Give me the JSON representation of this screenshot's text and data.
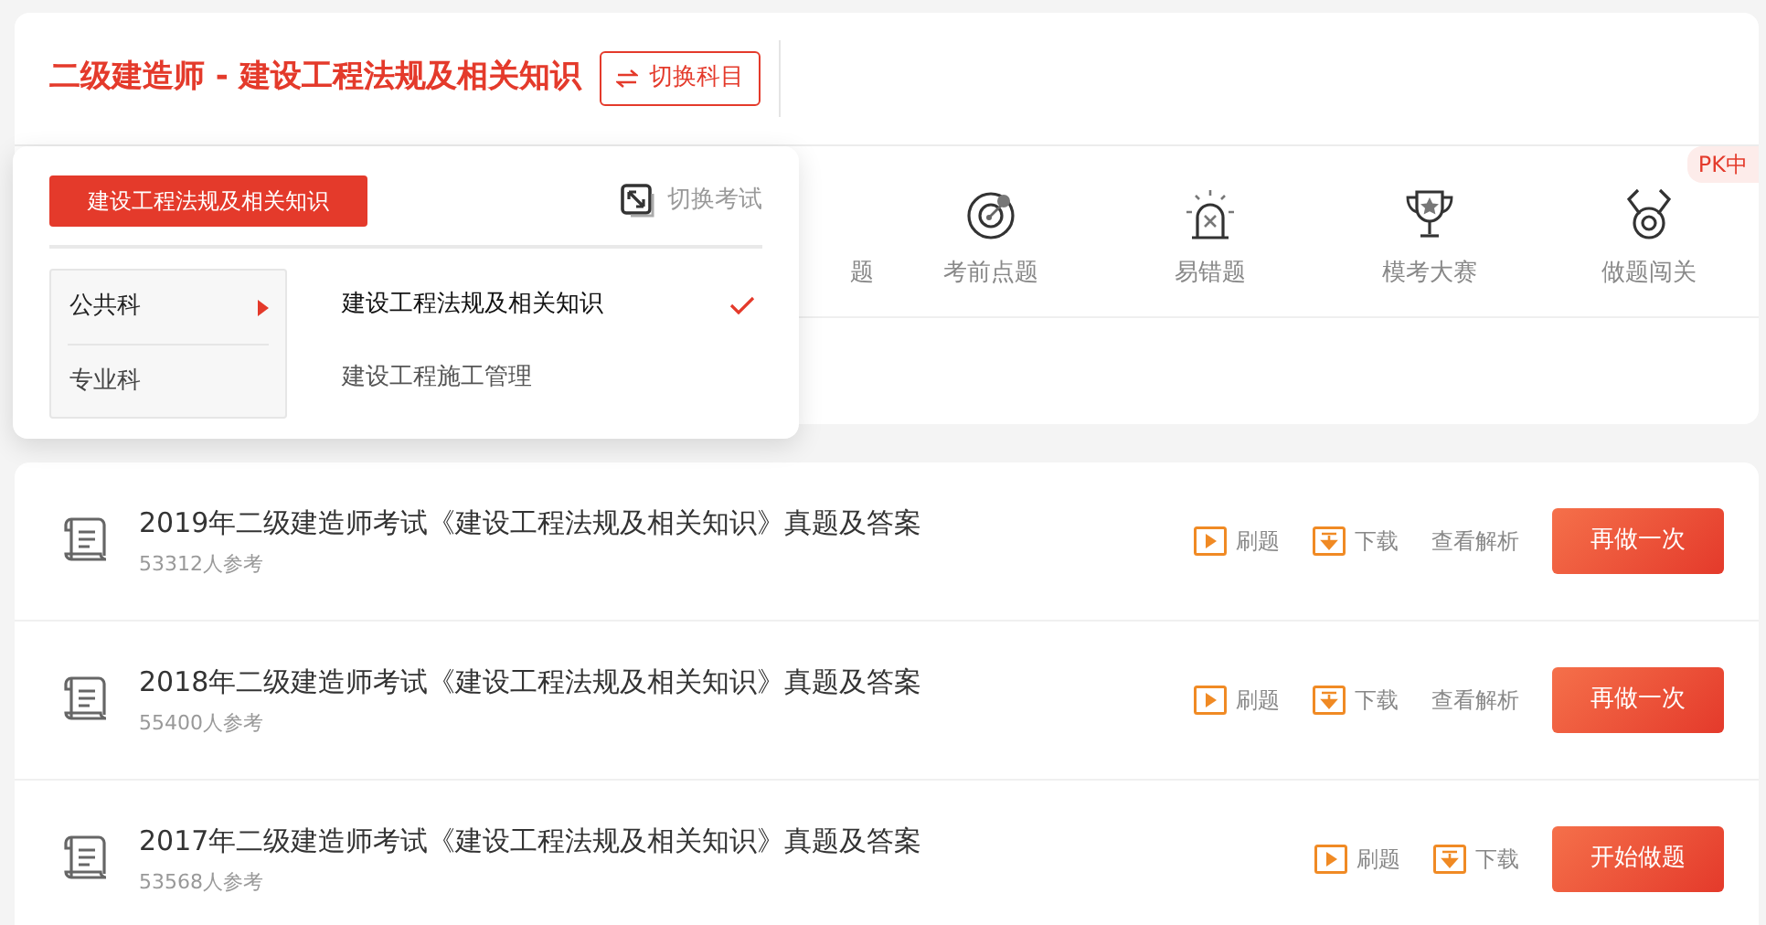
{
  "header": {
    "title": "二级建造师 - 建设工程法规及相关知识",
    "switch_button": "切换科目"
  },
  "tools": [
    {
      "kind": "partial",
      "label": "题"
    },
    {
      "kind": "target",
      "label": "考前点题"
    },
    {
      "kind": "alarm",
      "label": "易错题"
    },
    {
      "kind": "trophy",
      "label": "模考大赛"
    },
    {
      "kind": "medal",
      "label": "做题闯关",
      "badge": "PK中"
    }
  ],
  "dropdown": {
    "current": "建设工程法规及相关知识",
    "switch_exam": "切换考试",
    "categories": [
      {
        "label": "公共科",
        "selected": true
      },
      {
        "label": "专业科",
        "selected": false
      }
    ],
    "subjects": [
      {
        "label": "建设工程法规及相关知识",
        "selected": true
      },
      {
        "label": "建设工程施工管理",
        "selected": false
      }
    ]
  },
  "papers": [
    {
      "title": "2019年二级建造师考试《建设工程法规及相关知识》真题及答案",
      "count": "53312人参考",
      "practice": "刷题",
      "download": "下载",
      "analysis": "查看解析",
      "action": "再做一次"
    },
    {
      "title": "2018年二级建造师考试《建设工程法规及相关知识》真题及答案",
      "count": "55400人参考",
      "practice": "刷题",
      "download": "下载",
      "analysis": "查看解析",
      "action": "再做一次"
    },
    {
      "title": "2017年二级建造师考试《建设工程法规及相关知识》真题及答案",
      "count": "53568人参考",
      "practice": "刷题",
      "download": "下载",
      "action": "开始做题"
    }
  ]
}
